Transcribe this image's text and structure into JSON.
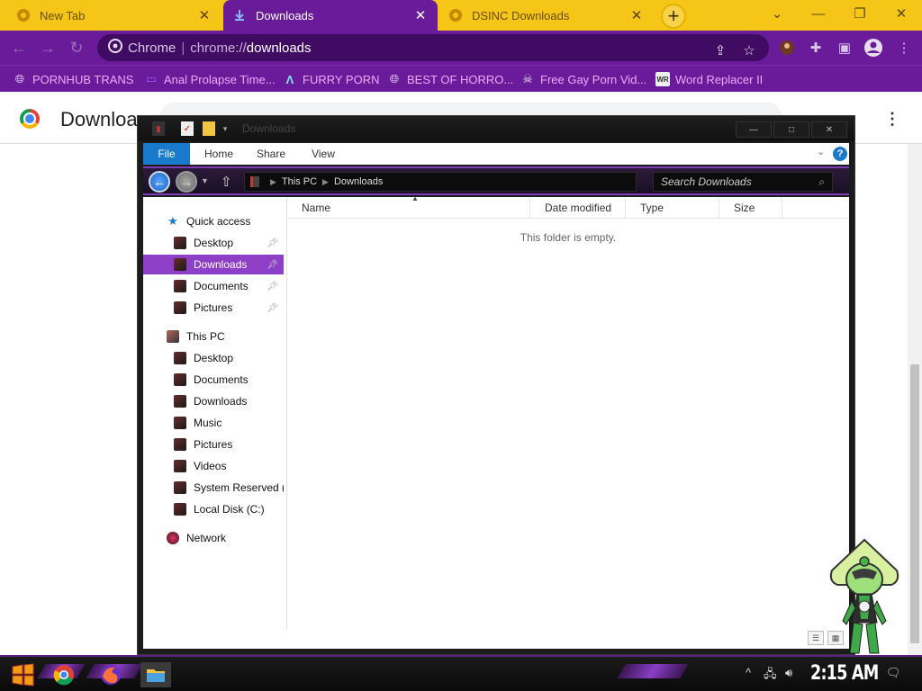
{
  "browser": {
    "tabs": [
      {
        "title": "New Tab",
        "active": false,
        "favicon": "chrome-icon"
      },
      {
        "title": "Downloads",
        "active": true,
        "favicon": "download-icon"
      },
      {
        "title": "DSINC Downloads",
        "active": false,
        "favicon": "chrome-icon"
      }
    ],
    "omnibox": {
      "label": "Chrome",
      "divider": "|",
      "scheme": "chrome://",
      "host": "downloads"
    },
    "bookmarks": [
      {
        "label": "PORNHUB TRANS",
        "icon": "globe-icon"
      },
      {
        "label": "Anal Prolapse Time...",
        "icon": "bookmark-icon"
      },
      {
        "label": "FURRY PORN",
        "icon": "lambda-icon"
      },
      {
        "label": "BEST OF HORRO...",
        "icon": "globe-icon"
      },
      {
        "label": "Free Gay Porn Vid...",
        "icon": "skull-icon"
      },
      {
        "label": "Word Replacer II",
        "icon": "wr-icon"
      }
    ],
    "page_title": "Downloa",
    "menu_glyph": "⋮"
  },
  "explorer": {
    "title": "Downloads",
    "window_buttons": {
      "minimize": "—",
      "maximize": "□",
      "close": "✕"
    },
    "ribbon": {
      "file": "File",
      "tabs": [
        "Home",
        "Share",
        "View"
      ],
      "help": "?"
    },
    "address": {
      "root": "This PC",
      "current": "Downloads"
    },
    "search_placeholder": "Search Downloads",
    "nav": {
      "quick_access": {
        "label": "Quick access",
        "items": [
          {
            "label": "Desktop",
            "pinned": true
          },
          {
            "label": "Downloads",
            "pinned": true,
            "selected": true
          },
          {
            "label": "Documents",
            "pinned": true
          },
          {
            "label": "Pictures",
            "pinned": true
          }
        ]
      },
      "this_pc": {
        "label": "This PC",
        "items": [
          {
            "label": "Desktop"
          },
          {
            "label": "Documents"
          },
          {
            "label": "Downloads"
          },
          {
            "label": "Music"
          },
          {
            "label": "Pictures"
          },
          {
            "label": "Videos"
          },
          {
            "label": "System Reserved (A"
          },
          {
            "label": "Local Disk (C:)"
          }
        ]
      },
      "network": {
        "label": "Network"
      }
    },
    "columns": [
      "Name",
      "Date modified",
      "Type",
      "Size"
    ],
    "empty_message": "This folder is empty."
  },
  "taskbar": {
    "clock": "2:15 AM",
    "apps": [
      "start-icon",
      "chrome-icon",
      "firefox-icon",
      "file-explorer-icon"
    ]
  },
  "colors": {
    "tabstrip": "#f5c518",
    "toolbar": "#6a1b9a",
    "bookmark_text": "#f1a7ff",
    "nav_selected": "#8e3fc7",
    "ribbon_file": "#1979ca"
  }
}
